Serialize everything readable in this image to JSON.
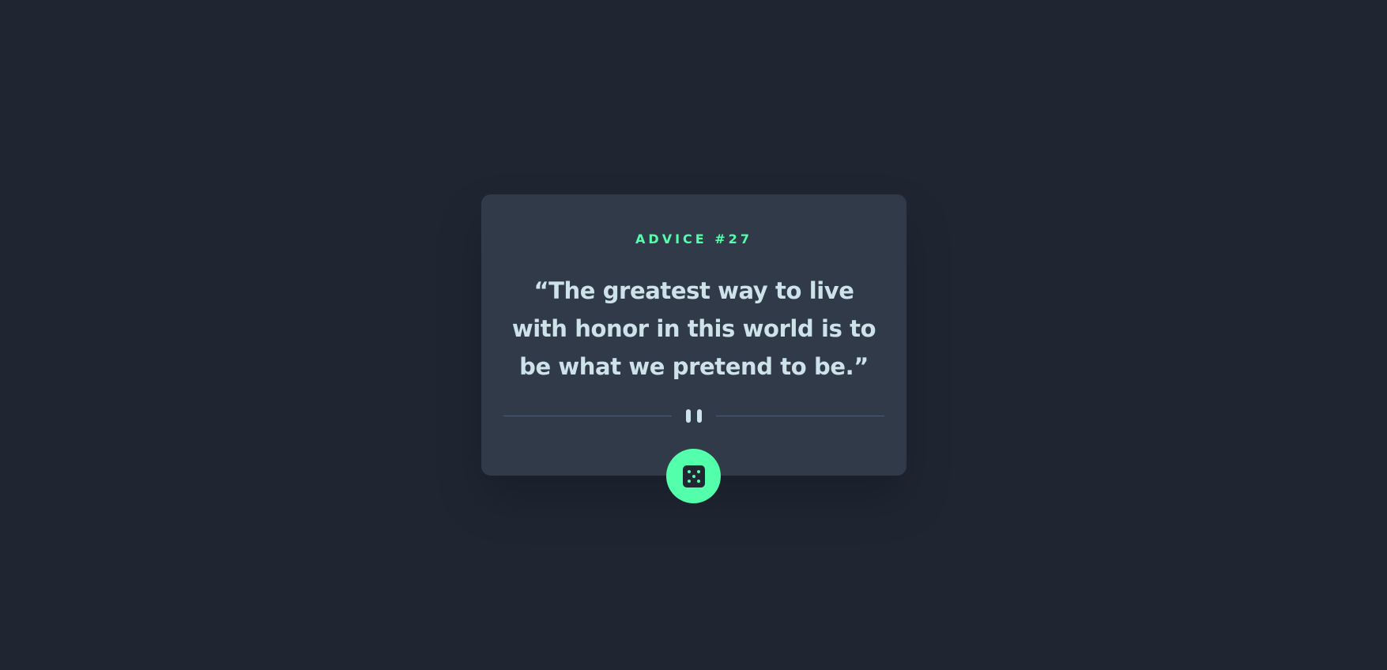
{
  "advice": {
    "label": "ADVICE #27",
    "quote": "“The greatest way to live with honor in this world is to be what we pretend to be.”"
  },
  "colors": {
    "background": "#1f2632",
    "card": "#313a49",
    "accent": "#53ffaa",
    "text": "#cee3e9",
    "divider": "#4f5d74"
  },
  "icons": {
    "divider": "pause-icon",
    "button": "dice-icon"
  }
}
